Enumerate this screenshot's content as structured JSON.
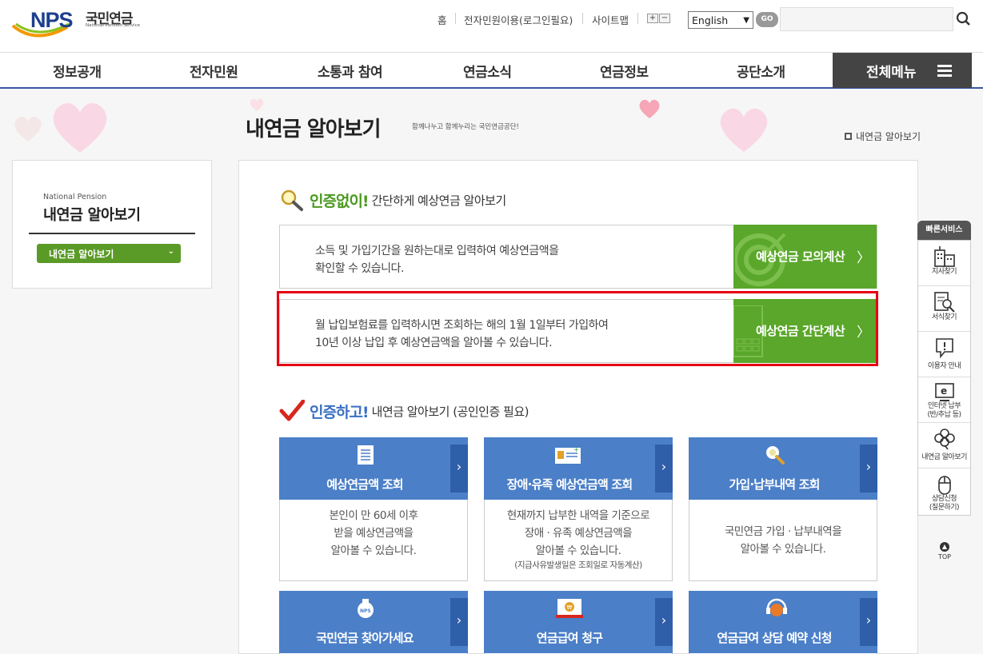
{
  "header": {
    "logo_text": "NPS",
    "logo_korean": "국민연금",
    "logo_english": "National Pension Service",
    "util_links": [
      "홈",
      "전자민원이용(로그인필요)",
      "사이트맵"
    ],
    "zoom_in": "+",
    "zoom_out": "−",
    "language_selected": "English",
    "go_label": "GO",
    "search_placeholder": ""
  },
  "gnb": {
    "items": [
      "정보공개",
      "전자민원",
      "소통과 참여",
      "연금소식",
      "연금정보",
      "공단소개"
    ],
    "all_menu": "전체메뉴"
  },
  "page": {
    "title": "내연금 알아보기",
    "subtitle": "함께나누고 함께누리는 국민연금공단!",
    "breadcrumb": "내연금 알아보기"
  },
  "lnb": {
    "english": "National Pension",
    "title": "내연금 알아보기",
    "selected": "내연금 알아보기"
  },
  "section1": {
    "em": "인증없이!",
    "rest": "간단하게 예상연금 알아보기",
    "rows": [
      {
        "desc_line1": "소득 및 가입기간을 원하는대로 입력하여 예상연금액을",
        "desc_line2": "확인할 수 있습니다.",
        "button": "예상연금 모의계산"
      },
      {
        "desc_line1": "월 납입보험료를 입력하시면 조회하는 해의 1월 1일부터 가입하여",
        "desc_line2": "10년 이상 납입 후 예상연금액을 알아볼 수 있습니다.",
        "button": "예상연금 간단계산"
      }
    ]
  },
  "section2": {
    "em": "인증하고!",
    "rest": "내연금 알아보기 (공인인증 필요)",
    "cards": [
      {
        "title": "예상연금액 조회",
        "lines": [
          "본인이 만 60세 이후",
          "받을 예상연금액을",
          "알아볼 수 있습니다."
        ],
        "note": ""
      },
      {
        "title": "장애·유족 예상연금액 조회",
        "lines": [
          "현재까지 납부한 내역을 기준으로",
          "장애 · 유족 예상연금액을",
          "알아볼 수 있습니다."
        ],
        "note": "(지급사유발생일은 조회일로 자동계산)"
      },
      {
        "title": "가입·납부내역 조회",
        "lines": [
          "국민연금 가입 · 납부내역을",
          "알아볼 수 있습니다."
        ],
        "note": ""
      },
      {
        "title": "국민연금 찾아가세요",
        "lines": [],
        "note": ""
      },
      {
        "title": "연금급여 청구",
        "lines": [],
        "note": ""
      },
      {
        "title": "연금급여 상담 예약 신청",
        "lines": [],
        "note": ""
      }
    ]
  },
  "quick": {
    "header": "빠른서비스",
    "items": [
      {
        "label1": "지사찾기",
        "label2": "",
        "icon": "building-icon"
      },
      {
        "label1": "서식찾기",
        "label2": "",
        "icon": "document-search-icon"
      },
      {
        "label1": "이용자 안내",
        "label2": "",
        "icon": "info-chat-icon"
      },
      {
        "label1": "인터넷 납부",
        "label2": "(반/추납 등)",
        "icon": "e-monitor-icon"
      },
      {
        "label1": "내연금 알아보기",
        "label2": "",
        "icon": "clover-icon"
      },
      {
        "label1": "상담신청",
        "label2": "(질문하기)",
        "icon": "mouse-icon"
      }
    ],
    "top": "TOP"
  },
  "colors": {
    "brand_blue": "#1d3f8f",
    "green": "#5aa72b",
    "card_blue": "#4b7fc8",
    "highlight_red": "#e60012"
  }
}
